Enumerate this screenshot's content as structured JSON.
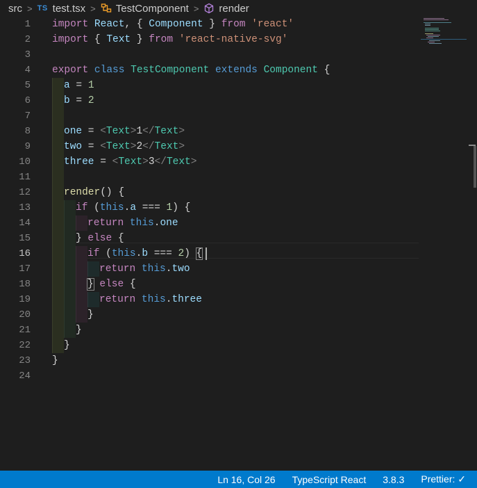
{
  "breadcrumb": {
    "folder": "src",
    "file_badge": "TS",
    "file": "test.tsx",
    "class_name": "TestComponent",
    "method": "render"
  },
  "editor": {
    "active_line": 16,
    "line_numbers": [
      "1",
      "2",
      "3",
      "4",
      "5",
      "6",
      "7",
      "8",
      "9",
      "10",
      "11",
      "12",
      "13",
      "14",
      "15",
      "16",
      "17",
      "18",
      "19",
      "20",
      "21",
      "22",
      "23",
      "24"
    ]
  },
  "code": {
    "l1": {
      "t1": "import",
      "t2": " React",
      "t3": ", { ",
      "t4": "Component",
      "t5": " } ",
      "t6": "from",
      "t7": " 'react'"
    },
    "l2": {
      "t1": "import",
      "t2": " { ",
      "t3": "Text",
      "t4": " } ",
      "t5": "from",
      "t6": " 'react-native-svg'"
    },
    "l4": {
      "t1": "export",
      "t2": " class ",
      "t3": "TestComponent",
      "t4": " extends ",
      "t5": "Component",
      "t6": " {"
    },
    "l5": {
      "t1": "a",
      "t2": " = ",
      "t3": "1"
    },
    "l6": {
      "t1": "b",
      "t2": " = ",
      "t3": "2"
    },
    "l8": {
      "t1": "one",
      "t2": " = ",
      "t3": "<",
      "t4": "Text",
      "t5": ">",
      "t6": "1",
      "t7": "</",
      "t8": "Text",
      "t9": ">"
    },
    "l9": {
      "t1": "two",
      "t2": " = ",
      "t3": "<",
      "t4": "Text",
      "t5": ">",
      "t6": "2",
      "t7": "</",
      "t8": "Text",
      "t9": ">"
    },
    "l10": {
      "t1": "three",
      "t2": " = ",
      "t3": "<",
      "t4": "Text",
      "t5": ">",
      "t6": "3",
      "t7": "</",
      "t8": "Text",
      "t9": ">"
    },
    "l12": {
      "t1": "render",
      "t2": "() {"
    },
    "l13": {
      "t1": "if",
      "t2": " (",
      "t3": "this",
      "t4": ".",
      "t5": "a",
      "t6": " === ",
      "t7": "1",
      "t8": ") {"
    },
    "l14": {
      "t1": "return",
      "t2": " this",
      "t3": ".",
      "t4": "one"
    },
    "l15": {
      "t1": "} ",
      "t2": "else",
      "t3": " {"
    },
    "l16": {
      "t1": "if",
      "t2": " (",
      "t3": "this",
      "t4": ".",
      "t5": "b",
      "t6": " === ",
      "t7": "2",
      "t8": ") ",
      "t9": "{"
    },
    "l17": {
      "t1": "return",
      "t2": " this",
      "t3": ".",
      "t4": "two"
    },
    "l18": {
      "t1": "}",
      "t2": " else",
      "t3": " {"
    },
    "l19": {
      "t1": "return",
      "t2": " this",
      "t3": ".",
      "t4": "three"
    },
    "l20": {
      "t1": "}"
    },
    "l21": {
      "t1": "}"
    },
    "l22": {
      "t1": "}"
    },
    "l23": {
      "t1": "}"
    }
  },
  "statusbar": {
    "position": "Ln 16, Col 26",
    "language": "TypeScript React",
    "version": "3.8.3",
    "formatter": "Prettier: ✓"
  },
  "colors": {
    "keyword": "#c586c0",
    "storage": "#569cd6",
    "class": "#4ec9b0",
    "variable": "#9cdcfe",
    "string": "#ce9178",
    "number": "#b5cea8",
    "function": "#dcdcaa",
    "statusbar": "#007acc"
  }
}
